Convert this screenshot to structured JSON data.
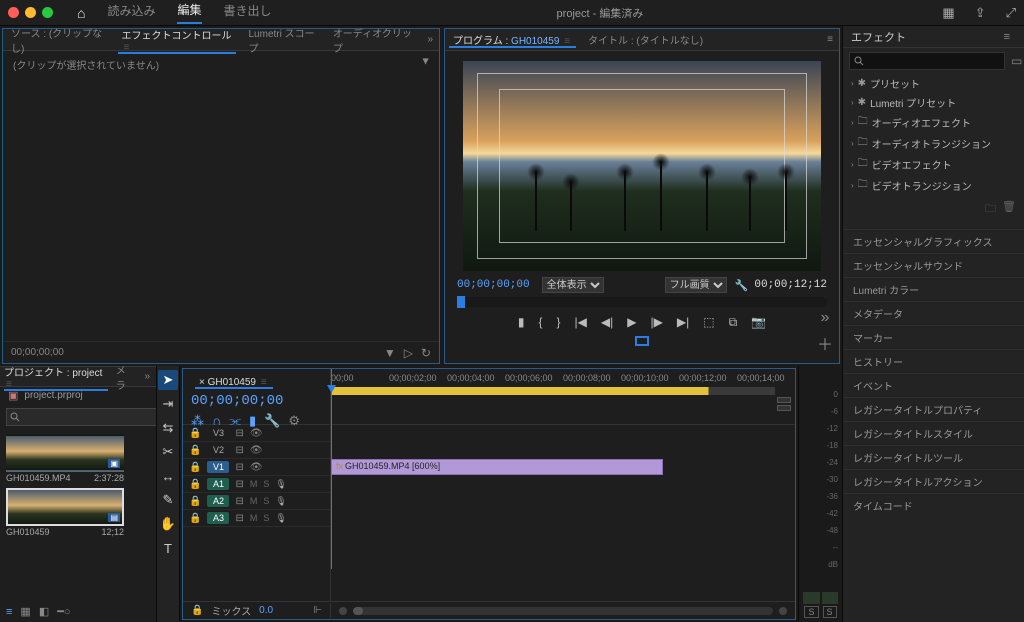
{
  "titlebar": {
    "title": "project - 編集済み",
    "tabs": {
      "import": "読み込み",
      "edit": "編集",
      "export": "書き出し"
    }
  },
  "source": {
    "tabs": {
      "source": "ソース : (クリップなし)",
      "effect_controls": "エフェクトコントロール",
      "lumetri": "Lumetri スコープ",
      "audio_clip": "オーディオクリップ"
    },
    "empty": "(クリップが選択されていません)",
    "tc": "00;00;00;00"
  },
  "program": {
    "tab_program": "プログラム :",
    "seq_name": "GH010459",
    "tab_title": "タイトル : (タイトルなし)",
    "tc_left": "00;00;00;00",
    "fit": "全体表示",
    "quality": "フル画質",
    "tc_right": "00;00;12;12"
  },
  "project": {
    "tab": "プロジェクト : project",
    "media_tab": "メラ",
    "file": "project.prproj",
    "items": [
      {
        "name": "GH010459.MP4",
        "dur": "2:37:28",
        "selected": false
      },
      {
        "name": "GH010459",
        "dur": "12;12",
        "selected": true
      }
    ]
  },
  "timeline": {
    "seq": "GH010459",
    "tc": "00;00;00;00",
    "ruler": [
      "00;00",
      "00;00;02;00",
      "00;00;04;00",
      "00;00;06;00",
      "00;00;08;00",
      "00;00;10;00",
      "00;00;12;00",
      "00;00;14;00"
    ],
    "tracks": {
      "v3": "V3",
      "v2": "V2",
      "v1": "V1",
      "a1": "A1",
      "a2": "A2",
      "a3": "A3",
      "mix": "ミックス",
      "mix_val": "0.0"
    },
    "clip": "GH010459.MP4 [600%]"
  },
  "meters": {
    "labels": [
      "0",
      "-6",
      "-12",
      "-18",
      "-24",
      "-30",
      "-36",
      "-42",
      "-48",
      "--"
    ],
    "db": "dB",
    "solo": "S"
  },
  "effects": {
    "title": "エフェクト",
    "tree": [
      "プリセット",
      "Lumetri プリセット",
      "オーディオエフェクト",
      "オーディオトランジション",
      "ビデオエフェクト",
      "ビデオトランジション"
    ],
    "panels": [
      "エッセンシャルグラフィックス",
      "エッセンシャルサウンド",
      "Lumetri カラー",
      "メタデータ",
      "マーカー",
      "ヒストリー",
      "イベント",
      "レガシータイトルプロパティ",
      "レガシータイトルスタイル",
      "レガシータイトルツール",
      "レガシータイトルアクション",
      "タイムコード"
    ]
  },
  "search_placeholder": ""
}
